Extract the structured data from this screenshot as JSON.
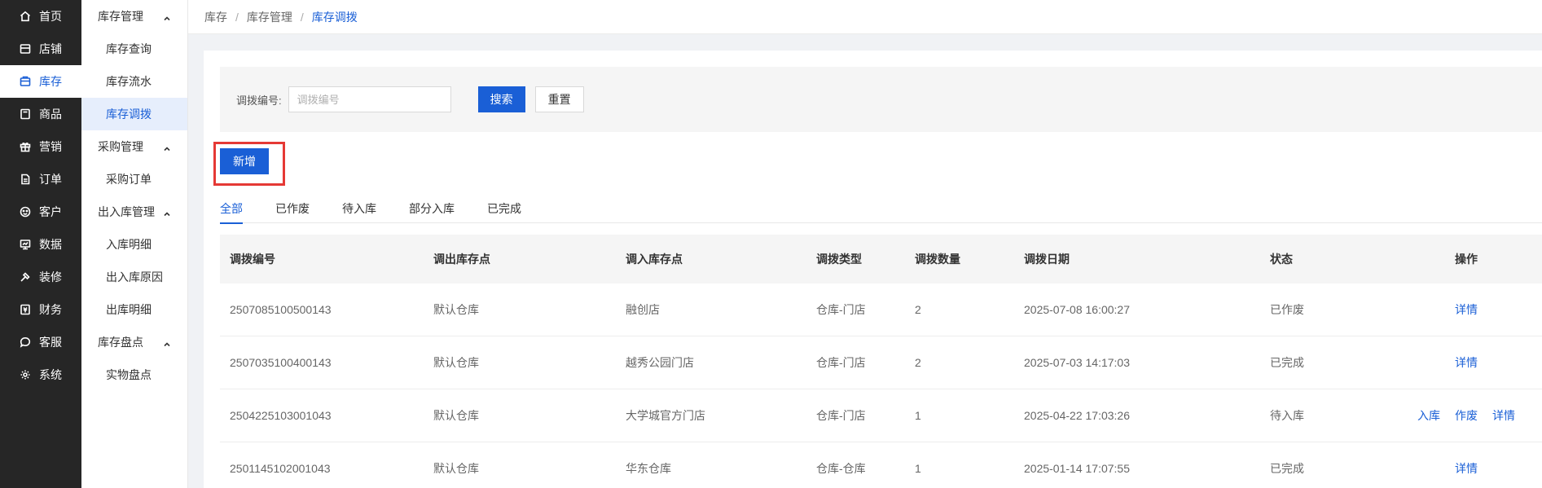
{
  "nav1": {
    "items": [
      {
        "label": "首页",
        "icon": "home-icon"
      },
      {
        "label": "店铺",
        "icon": "store-icon"
      },
      {
        "label": "库存",
        "icon": "inventory-icon"
      },
      {
        "label": "商品",
        "icon": "product-icon"
      },
      {
        "label": "营销",
        "icon": "gift-icon"
      },
      {
        "label": "订单",
        "icon": "order-icon"
      },
      {
        "label": "客户",
        "icon": "customer-icon"
      },
      {
        "label": "数据",
        "icon": "data-icon"
      },
      {
        "label": "装修",
        "icon": "decorate-icon"
      },
      {
        "label": "财务",
        "icon": "finance-icon"
      },
      {
        "label": "客服",
        "icon": "chat-icon"
      },
      {
        "label": "系统",
        "icon": "gear-icon"
      }
    ],
    "active_index": 2
  },
  "nav2": {
    "groups": [
      {
        "label": "库存管理",
        "items": [
          "库存查询",
          "库存流水",
          "库存调拨"
        ]
      },
      {
        "label": "采购管理",
        "items": [
          "采购订单"
        ]
      },
      {
        "label": "出入库管理",
        "items": [
          "入库明细",
          "出入库原因",
          "出库明细"
        ]
      },
      {
        "label": "库存盘点",
        "items": [
          "实物盘点"
        ]
      }
    ],
    "active_item": "库存调拨"
  },
  "breadcrumb": {
    "items": [
      "库存",
      "库存管理",
      "库存调拨"
    ],
    "separator": "/"
  },
  "search": {
    "label": "调拨编号:",
    "placeholder": "调拨编号",
    "value": "",
    "search_button": "搜索",
    "reset_button": "重置"
  },
  "add_button": "新增",
  "tabs": {
    "items": [
      "全部",
      "已作废",
      "待入库",
      "部分入库",
      "已完成"
    ],
    "active_index": 0
  },
  "table": {
    "columns": [
      "调拨编号",
      "调出库存点",
      "调入库存点",
      "调拨类型",
      "调拨数量",
      "调拨日期",
      "状态",
      "操作"
    ],
    "rows": [
      {
        "id": "2507085100500143",
        "from": "默认仓库",
        "to": "融创店",
        "type": "仓库-门店",
        "qty": "2",
        "date": "2025-07-08 16:00:27",
        "status": "已作废",
        "actions": [
          "详情"
        ]
      },
      {
        "id": "2507035100400143",
        "from": "默认仓库",
        "to": "越秀公园门店",
        "type": "仓库-门店",
        "qty": "2",
        "date": "2025-07-03 14:17:03",
        "status": "已完成",
        "actions": [
          "详情"
        ]
      },
      {
        "id": "2504225103001043",
        "from": "默认仓库",
        "to": "大学城官方门店",
        "type": "仓库-门店",
        "qty": "1",
        "date": "2025-04-22 17:03:26",
        "status": "待入库",
        "actions": [
          "入库",
          "作废",
          "详情"
        ]
      },
      {
        "id": "2501145102001043",
        "from": "默认仓库",
        "to": "华东仓库",
        "type": "仓库-仓库",
        "qty": "1",
        "date": "2025-01-14 17:07:55",
        "status": "已完成",
        "actions": [
          "详情"
        ]
      }
    ]
  },
  "colors": {
    "primary": "#1a5fd6",
    "nav_bg": "#262626",
    "highlight": "#e53935"
  }
}
